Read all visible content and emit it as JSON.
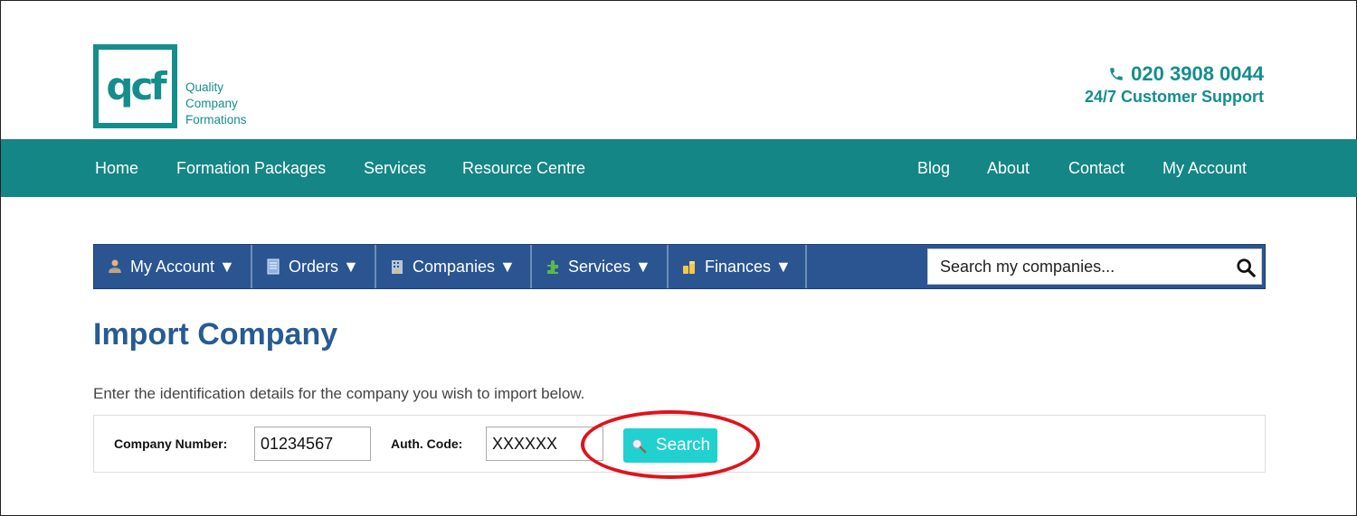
{
  "brand": {
    "logo_mark": "qcf",
    "name_lines": [
      "Quality",
      "Company",
      "Formations"
    ],
    "color": "#148d8d"
  },
  "support": {
    "phone": "020 3908 0044",
    "line": "24/7 Customer Support",
    "icon": "phone-icon"
  },
  "main_nav": {
    "left": [
      "Home",
      "Formation Packages",
      "Services",
      "Resource Centre"
    ],
    "right": [
      "Blog",
      "About",
      "Contact",
      "My Account"
    ],
    "background": "#138685"
  },
  "account_bar": {
    "items": [
      {
        "label": "My Account ▼",
        "icon": "account-icon"
      },
      {
        "label": "Orders ▼",
        "icon": "orders-icon"
      },
      {
        "label": "Companies ▼",
        "icon": "companies-icon"
      },
      {
        "label": "Services ▼",
        "icon": "services-icon"
      },
      {
        "label": "Finances ▼",
        "icon": "finances-icon"
      }
    ],
    "search_placeholder": "Search my companies...",
    "background": "#2a5591"
  },
  "page": {
    "title": "Import Company",
    "intro": "Enter the identification details for the company you wish to import below."
  },
  "form": {
    "company_number_label": "Company Number:",
    "company_number_value": "01234567",
    "auth_code_label": "Auth. Code:",
    "auth_code_value": "XXXXXX",
    "search_label": "Search",
    "button_color": "#20d1d0",
    "highlight_color": "#e0131b"
  }
}
